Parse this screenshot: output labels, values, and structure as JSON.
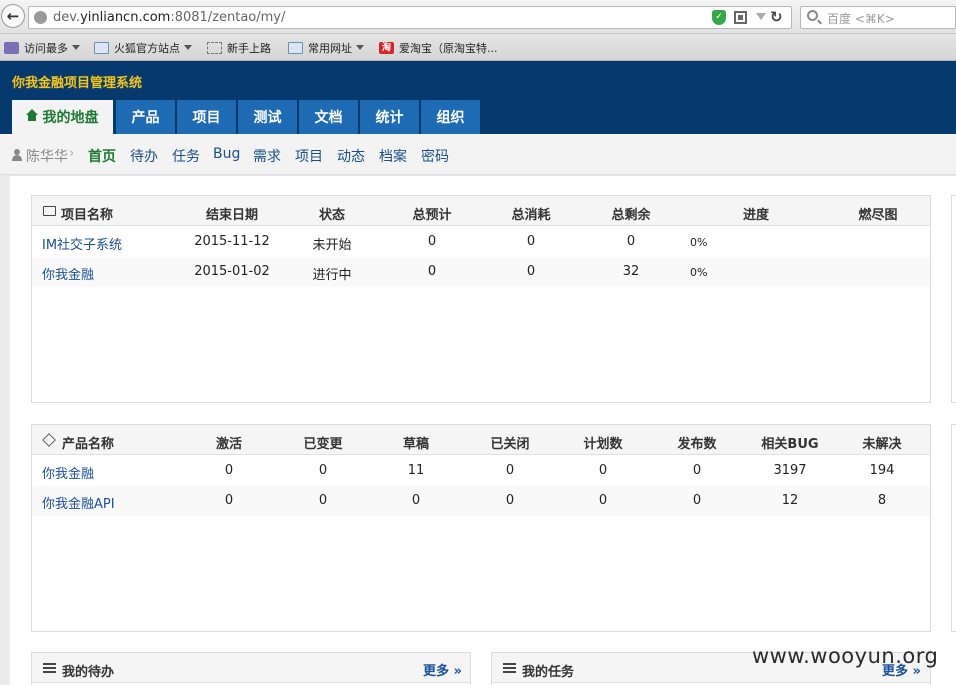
{
  "browser": {
    "url_prefix": "dev.",
    "url_domain": "yinliancn.com",
    "url_rest": ":8081/zentao/my/",
    "search_placeholder": "百度 <⌘K>",
    "bookmarks": [
      {
        "label": "访问最多",
        "icon": "most-visited-icon",
        "has_menu": true
      },
      {
        "label": "火狐官方站点",
        "icon": "folder-icon",
        "has_menu": true
      },
      {
        "label": "新手上路",
        "icon": "page-icon",
        "has_menu": false
      },
      {
        "label": "常用网址",
        "icon": "folder-icon",
        "has_menu": true
      },
      {
        "label": "爱淘宝（原淘宝特...",
        "icon": "taobao-icon",
        "has_menu": false
      }
    ],
    "taobao_glyph": "淘"
  },
  "app": {
    "title": "你我金融项目管理系统",
    "tabs": [
      "我的地盘",
      "产品",
      "项目",
      "测试",
      "文档",
      "统计",
      "组织"
    ],
    "active_tab": 0,
    "colors": {
      "header": "#063a6e",
      "tab": "#1f6bb3",
      "active_text": "#1e7a32",
      "title": "#f5c518",
      "link": "#1a4f9a"
    }
  },
  "subnav": {
    "user": "陈华华",
    "separator": "›",
    "items": [
      "首页",
      "待办",
      "任务",
      "Bug",
      "需求",
      "项目",
      "动态",
      "档案",
      "密码"
    ],
    "active": 0
  },
  "projects": {
    "columns": [
      "项目名称",
      "结束日期",
      "状态",
      "总预计",
      "总消耗",
      "总剩余",
      "进度",
      "燃尽图"
    ],
    "rows": [
      {
        "name": "IM社交子系统",
        "end": "2015-11-12",
        "status": "未开始",
        "estimate": "0",
        "consumed": "0",
        "left": "0",
        "progress": "0%"
      },
      {
        "name": "你我金融",
        "end": "2015-01-02",
        "status": "进行中",
        "estimate": "0",
        "consumed": "0",
        "left": "32",
        "progress": "0%"
      }
    ]
  },
  "products": {
    "columns": [
      "产品名称",
      "激活",
      "已变更",
      "草稿",
      "已关闭",
      "计划数",
      "发布数",
      "相关BUG",
      "未解决"
    ],
    "rows": [
      {
        "name": "你我金融",
        "active": "0",
        "changed": "0",
        "draft": "11",
        "closed": "0",
        "plans": "0",
        "releases": "0",
        "bugs": "3197",
        "unresolved": "194"
      },
      {
        "name": "你我金融API",
        "active": "0",
        "changed": "0",
        "draft": "0",
        "closed": "0",
        "plans": "0",
        "releases": "0",
        "bugs": "12",
        "unresolved": "8"
      }
    ]
  },
  "todo_panel": {
    "title": "我的待办",
    "more": "更多 »"
  },
  "task_panel": {
    "title": "我的任务",
    "more": "更多 »"
  },
  "watermark": "www.wooyun.org"
}
